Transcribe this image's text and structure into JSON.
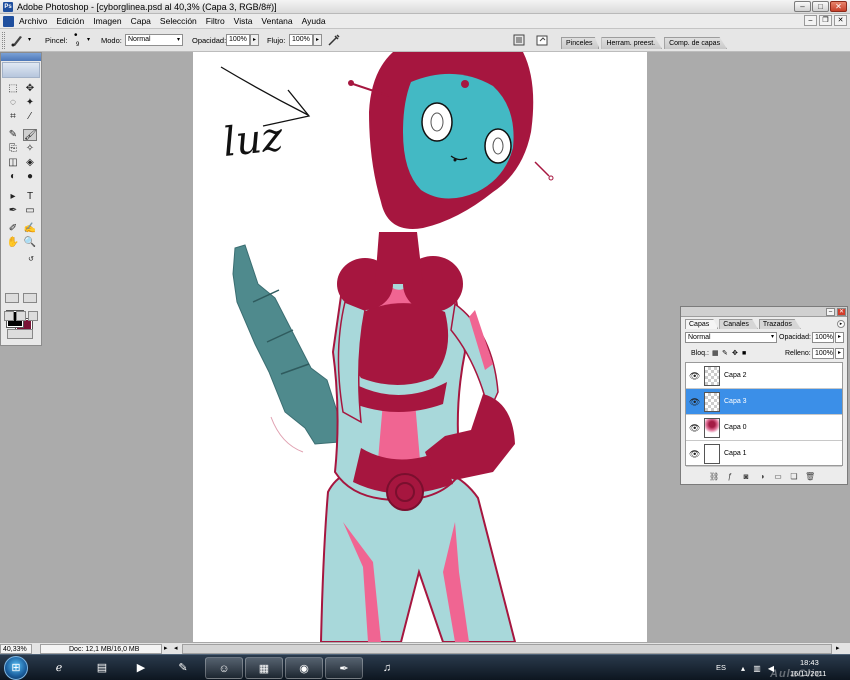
{
  "window": {
    "title": "Adobe Photoshop - [cyborglinea.psd al 40,3% (Capa 3, RGB/8#)]",
    "app_logo": "Ps",
    "min_glyph": "–",
    "max_glyph": "□",
    "close_glyph": "✕"
  },
  "menubar": {
    "items": [
      "Archivo",
      "Edición",
      "Imagen",
      "Capa",
      "Selección",
      "Filtro",
      "Vista",
      "Ventana",
      "Ayuda"
    ],
    "doc_min": "–",
    "doc_restore": "❐",
    "doc_close": "✕"
  },
  "options": {
    "brush_label": "Pincel:",
    "brush_size": "9",
    "mode_label": "Modo:",
    "mode_value": "Normal",
    "opacity_label": "Opacidad:",
    "opacity_value": "100%",
    "flow_label": "Flujo:",
    "flow_value": "100%",
    "arrow": "▸",
    "dropdown": "▾",
    "panel_tabs": [
      "Pinceles",
      "Herram. preest.",
      "Comp. de capas"
    ]
  },
  "toolbox": {
    "tools": [
      "⬚",
      "✥",
      "◌",
      "✦",
      "⌗",
      "⁄",
      "✎",
      "🖌",
      "⎘",
      "✧",
      "◫",
      "◈",
      "◐",
      "●",
      "▸",
      "T",
      "✒",
      "▭",
      "✐",
      "✍",
      "✋",
      "🔍"
    ]
  },
  "layers_panel": {
    "tabs": [
      "Capas",
      "Canales",
      "Trazados"
    ],
    "blend_mode": "Normal",
    "opacity_label": "Opacidad:",
    "opacity_value": "100%",
    "lock_label": "Bloq.:",
    "fill_label": "Relleno:",
    "fill_value": "100%",
    "eye_glyph": "👁",
    "layers": [
      {
        "name": "Capa 2",
        "selected": false,
        "thumb": "transparent"
      },
      {
        "name": "Capa 3",
        "selected": true,
        "thumb": "transparent"
      },
      {
        "name": "Capa 0",
        "selected": false,
        "thumb": "art"
      },
      {
        "name": "Capa 1",
        "selected": false,
        "thumb": "white"
      }
    ],
    "footer_icons": [
      "link-icon",
      "fx-icon",
      "mask-icon",
      "adjustment-icon",
      "group-icon",
      "new-layer-icon",
      "trash-icon"
    ]
  },
  "canvas": {
    "annotation_text": "luz"
  },
  "statusbar": {
    "zoom": "40,33%",
    "doc": "Doc: 12,1 MB/16,0 MB",
    "nav_arrow": "▸",
    "nav_left": "◂"
  },
  "taskbar": {
    "start": "⊞",
    "language": "ES",
    "time": "18:43",
    "date": "16/11/2011",
    "watermark": "AulaClic"
  },
  "colors": {
    "foreground": "#000000",
    "background": "#7a1436",
    "selection": "#3b8fe8",
    "robot_body": "#a6163f",
    "robot_face": "#43b9c4",
    "robot_pink": "#f06592",
    "robot_suit": "#a8d8da",
    "robot_gun": "#4f8a8d"
  }
}
